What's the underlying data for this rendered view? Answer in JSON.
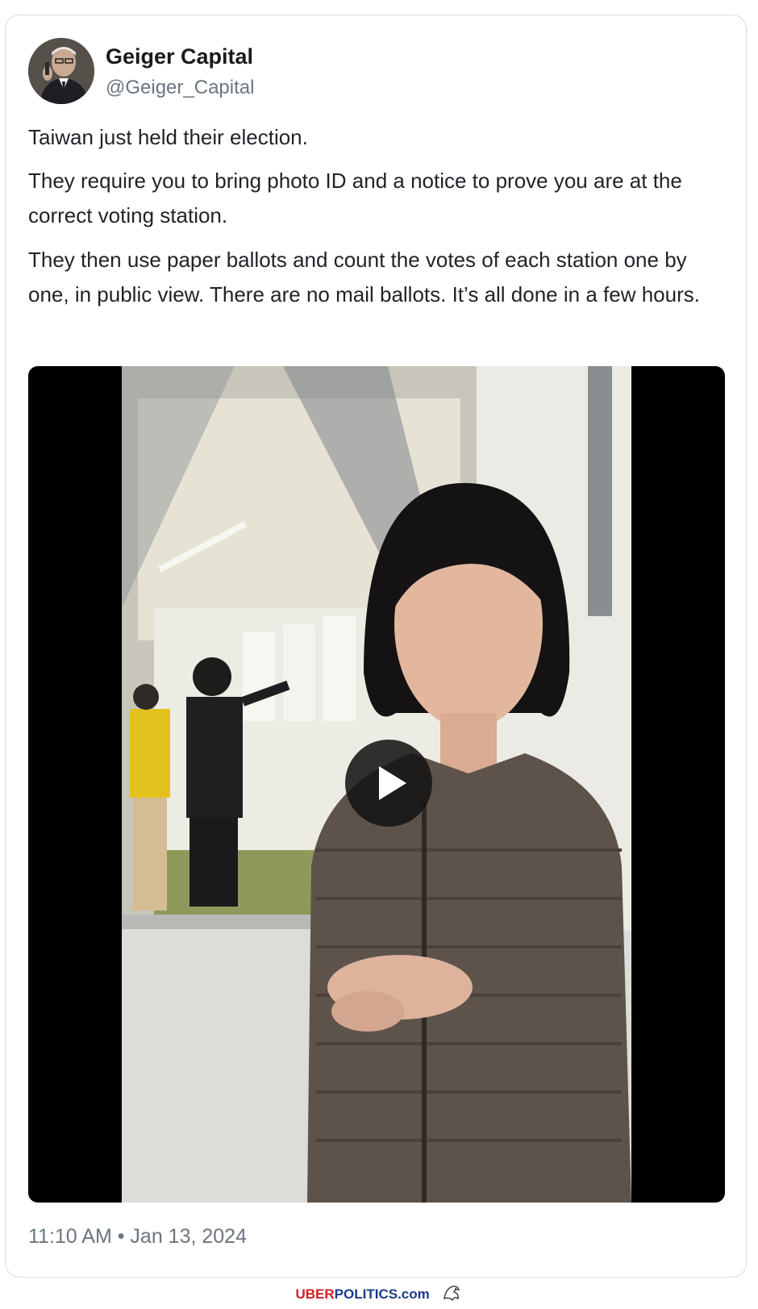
{
  "tweet": {
    "author_name": "Geiger Capital",
    "author_handle": "@Geiger_Capital",
    "paragraphs": [
      "Taiwan just held their election.",
      "They require you to bring photo ID and a notice to prove you are at the correct voting station.",
      "They then use paper ballots and count the votes of each station one by one, in public view. There are no mail ballots. It’s all done in a few hours."
    ],
    "timestamp": "11:10 AM • Jan 13, 2024",
    "media": {
      "type": "video",
      "play_icon": "play-icon"
    }
  },
  "footer": {
    "brand_part1": "UBER",
    "brand_part2": "POLITICS.com",
    "logo_icon": "eagle-icon"
  }
}
